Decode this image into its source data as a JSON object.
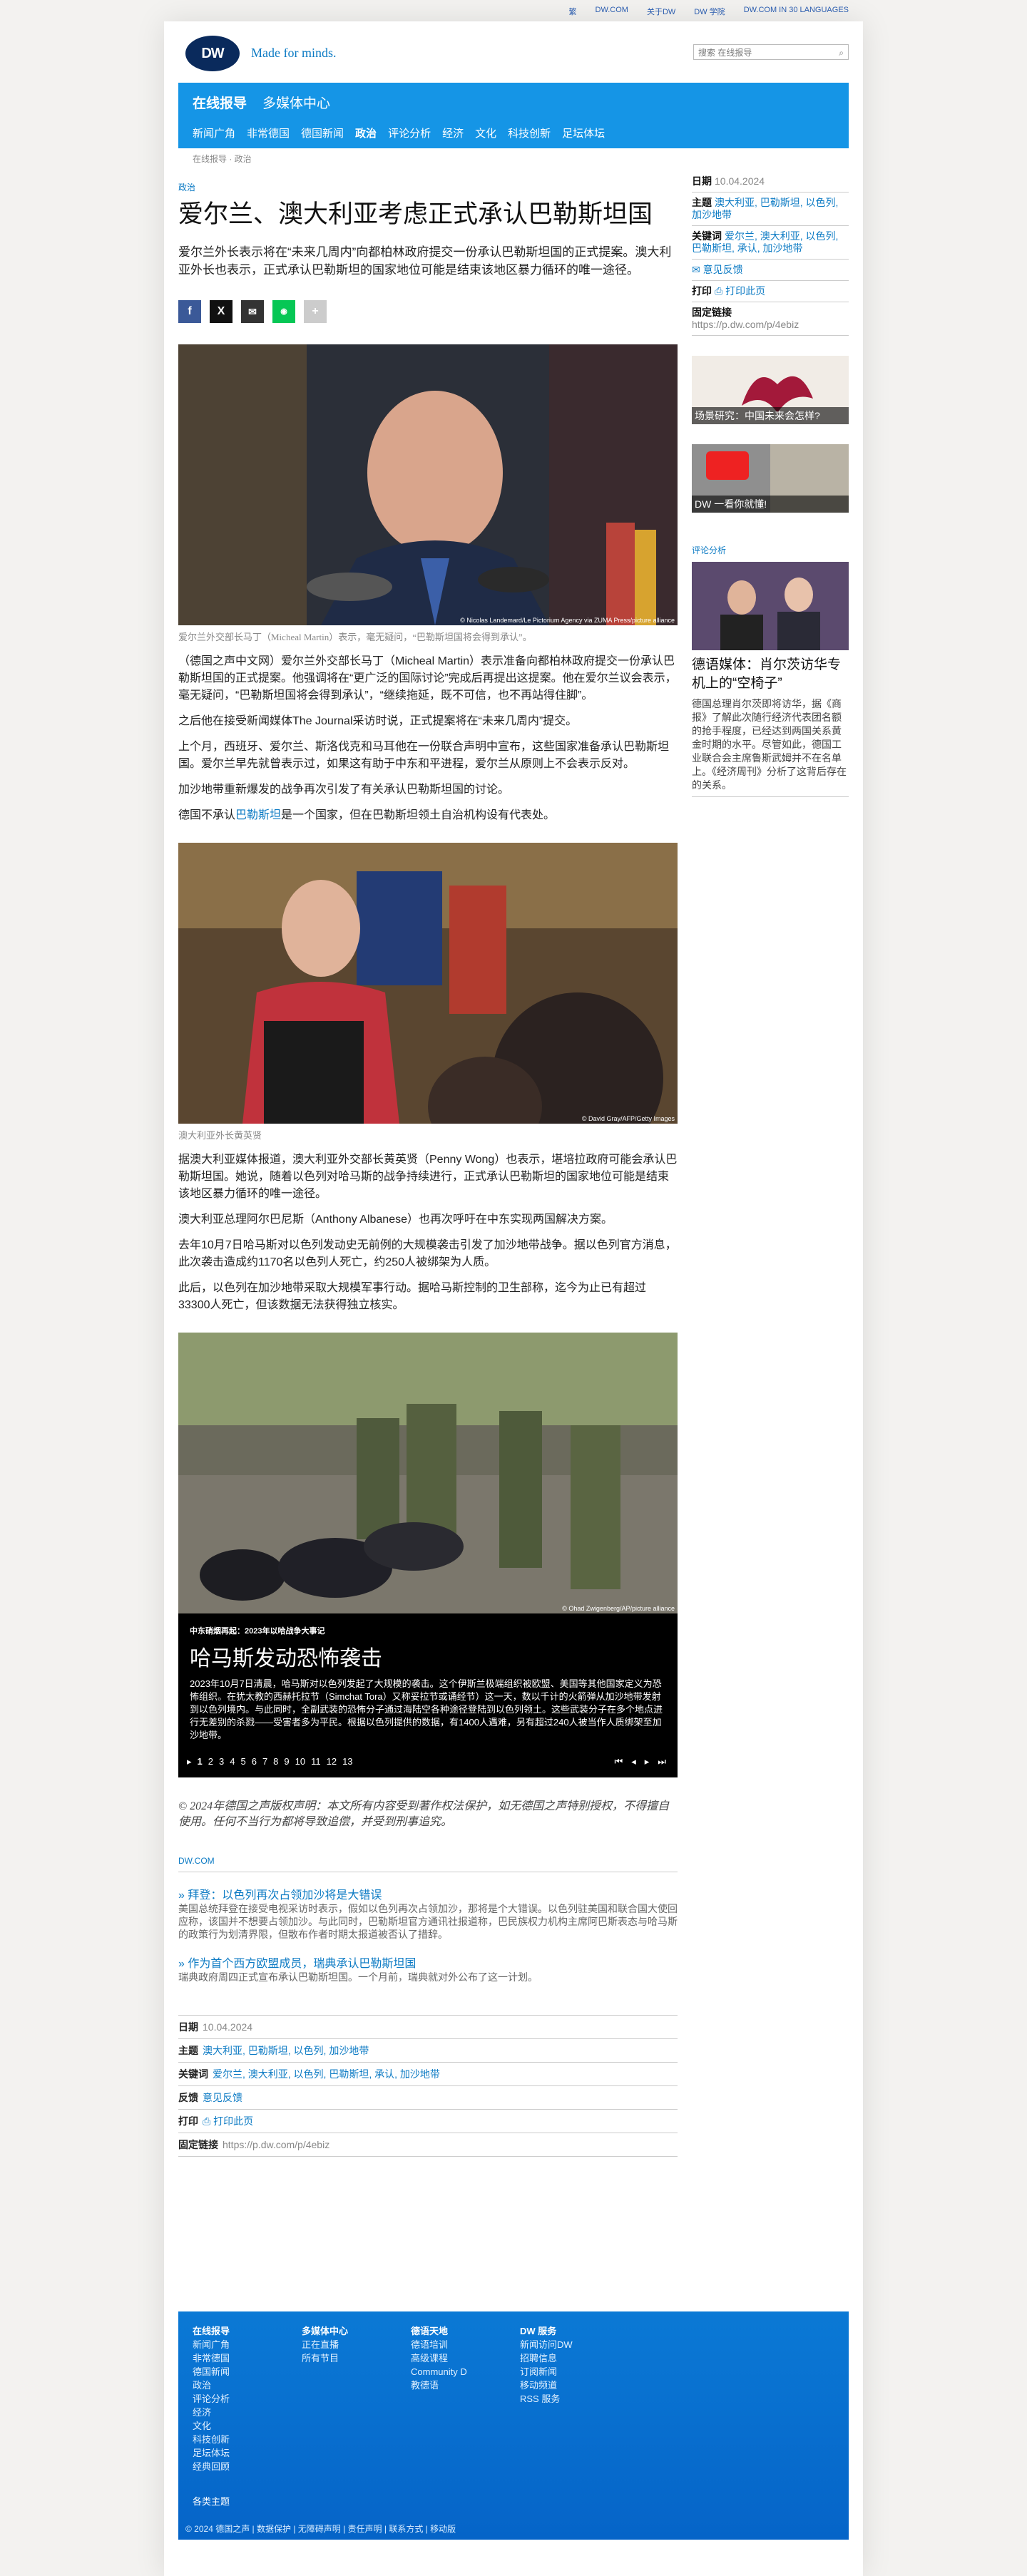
{
  "topbar": {
    "links": [
      "繁",
      "DW.COM",
      "关于DW",
      "DW 学院",
      "DW.COM IN 30 LANGUAGES"
    ]
  },
  "header": {
    "logo": "DW",
    "slogan": "Made for minds.",
    "search_placeholder": "搜索 在线报导"
  },
  "nav": {
    "sections": [
      "在线报导",
      "多媒体中心"
    ],
    "items": [
      "新闻广角",
      "非常德国",
      "德国新闻",
      "政治",
      "评论分析",
      "经济",
      "文化",
      "科技创新",
      "足坛体坛"
    ]
  },
  "breadcrumb": "在线报导 · 政治",
  "article": {
    "kicker": "政治",
    "title": "爱尔兰、澳大利亚考虑正式承认巴勒斯坦国",
    "lead": "爱尔兰外长表示将在“未来几周内”向都柏林政府提交一份承认巴勒斯坦国的正式提案。澳大利亚外长也表示，正式承认巴勒斯坦的国家地位可能是结束该地区暴力循环的唯一途径。",
    "photo1_credit": "© Nicolas Landemard/Le Pictorium Agency via ZUMA Press/picture alliance",
    "photo1_caption": "爱尔兰外交部长马丁（Micheal Martin）表示，毫无疑问，“巴勒斯坦国将会得到承认”。",
    "p1": "（德国之声中文网）爱尔兰外交部长马丁（Micheal Martin）表示准备向都柏林政府提交一份承认巴勒斯坦国的正式提案。他强调将在“更广泛的国际讨论”完成后再提出这提案。他在爱尔兰议会表示，毫无疑问，“巴勒斯坦国将会得到承认”，“继续拖延，既不可信，也不再站得住脚”。",
    "p2": "之后他在接受新闻媒体The Journal采访时说，正式提案将在“未来几周内”提交。",
    "p3": "上个月，西班牙、爱尔兰、斯洛伐克和马耳他在一份联合声明中宣布，这些国家准备承认巴勒斯坦国。爱尔兰早先就曾表示过，如果这有助于中东和平进程，爱尔兰从原则上不会表示反对。",
    "p4": "加沙地带重新爆发的战争再次引发了有关承认巴勒斯坦国的讨论。",
    "p5_a": "德国不承认",
    "p5_link": "巴勒斯坦",
    "p5_b": "是一个国家，但在巴勒斯坦领土自治机构设有代表处。",
    "photo2_credit": "© David Gray/AFP/Getty Images",
    "photo2_caption": "澳大利亚外长黄英贤",
    "p6": "据澳大利亚媒体报道，澳大利亚外交部长黄英贤（Penny Wong）也表示，堪培拉政府可能会承认巴勒斯坦国。她说，随着以色列对哈马斯的战争持续进行，正式承认巴勒斯坦的国家地位可能是结束该地区暴力循环的唯一途径。",
    "p7": "澳大利亚总理阿尔巴尼斯（Anthony Albanese）也再次呼吁在中东实现两国解决方案。",
    "p8": "去年10月7日哈马斯对以色列发动史无前例的大规模袭击引发了加沙地带战争。据以色列官方消息，此次袭击造成约1170名以色列人死亡，约250人被绑架为人质。",
    "p9": "此后，以色列在加沙地带采取大规模军事行动。据哈马斯控制的卫生部称，迄今为止已有超过33300人死亡，但该数据无法获得独立核实。",
    "gallery": {
      "credit": "© Ohad Zwigenberg/AP/picture alliance",
      "kicker": "中东硝烟再起：2023年以哈战争大事记",
      "title": "哈马斯发动恐怖袭击",
      "desc": "2023年10月7日清晨，哈马斯对以色列发起了大规模的袭击。这个伊斯兰极端组织被欧盟、美国等其他国家定义为恐怖组织。在犹太教的西赫托拉节（Simchat Tora）又称妥拉节或诵经节）这一天，数以千计的火箭弹从加沙地带发射到以色列境内。与此同时，全副武装的恐怖分子通过海陆空各种途径登陆到以色列领土。这些武装分子在多个地点进行无差别的杀戮——受害者多为平民。根据以色列提供的数据，有1400人遇难，另有超过240人被当作人质绑架至加沙地带。",
      "pages": [
        "1",
        "2",
        "3",
        "4",
        "5",
        "6",
        "7",
        "8",
        "9",
        "10",
        "11",
        "12",
        "13"
      ]
    },
    "copyright": "© 2024年德国之声版权声明：本文所有内容受到著作权法保护，如无德国之声特别授权，不得擅自使用。任何不当行为都将导致追偿，并受到刑事追究。"
  },
  "related": {
    "section": "DW.COM",
    "items": [
      {
        "title": "拜登：以色列再次占领加沙将是大错误",
        "desc": "美国总统拜登在接受电视采访时表示，假如以色列再次占领加沙，那将是个大错误。以色列驻美国和联合国大使回应称，该国并不想要占领加沙。与此同时，巴勒斯坦官方通讯社报道称，巴民族权力机构主席阿巴斯表态与哈马斯的政策行为划清界限，但散布作者时期太报道被否认了措辞。"
      },
      {
        "title": "作为首个西方欧盟成员，瑞典承认巴勒斯坦国",
        "desc": "瑞典政府周四正式宣布承认巴勒斯坦国。一个月前，瑞典就对外公布了这一计划。"
      }
    ]
  },
  "meta": {
    "date_label": "日期",
    "date": "10.04.2024",
    "topics_label": "主题",
    "topics": "澳大利亚, 巴勒斯坦, 以色列, 加沙地带",
    "keywords_label": "关键词",
    "keywords": "爱尔兰, 澳大利亚, 以色列, 巴勒斯坦, 承认, 加沙地带",
    "feedback_label": "反馈",
    "feedback": "意见反馈",
    "print_label": "打印",
    "print": "打印此页",
    "permalink_label": "固定链接",
    "permalink": "https://p.dw.com/p/4ebiz"
  },
  "sidebar": {
    "date_label": "日期",
    "date": "10.04.2024",
    "topics_label": "主题",
    "topics": "澳大利亚, 巴勒斯坦, 以色列, 加沙地带",
    "keywords_label": "关键词",
    "keywords": "爱尔兰, 澳大利亚, 以色列, 巴勒斯坦, 承认, 加沙地带",
    "feedback": "意见反馈",
    "print_label": "打印",
    "print": "打印此页",
    "permalink_label": "固定链接",
    "permalink": "https://p.dw.com/p/4ebiz",
    "teaser1": "场景研究：中国未来会怎样?",
    "teaser2": "DW 一看你就懂!",
    "commentary_label": "评论分析",
    "commentary_title": "德语媒体：肖尔茨访华专机上的“空椅子”",
    "commentary_desc": "德国总理肖尔茨即将访华，据《商报》了解此次随行经济代表团名额的抢手程度，已经达到两国关系黄金时期的水平。尽管如此，德国工业联合会主席鲁斯武姆并不在名单上。《经济周刊》分析了这背后存在的关系。"
  },
  "footer": {
    "columns": [
      {
        "head": "在线报导",
        "items": [
          "新闻广角",
          "非常德国",
          "德国新闻",
          "政治",
          "评论分析",
          "经济",
          "文化",
          "科技创新",
          "足坛体坛",
          "经典回顾"
        ]
      },
      {
        "head": "多媒体中心",
        "items": [
          "正在直播",
          "所有节目"
        ]
      },
      {
        "head": "德语天地",
        "items": [
          "德语培训",
          "高级课程",
          "Community D",
          "教德语"
        ]
      },
      {
        "head": "DW 服务",
        "items": [
          "新闻访问DW",
          "招聘信息",
          "订阅新闻",
          "移动频道",
          "RSS 服务"
        ]
      }
    ],
    "all_topics": "各类主题",
    "legal": "© 2024 德国之声 | 数据保护 | 无障碍声明 | 责任声明 | 联系方式 | 移动版"
  },
  "colors": {
    "brand_blue": "#1595e6",
    "link": "#0d7bc4",
    "footer": "#0564c8"
  }
}
